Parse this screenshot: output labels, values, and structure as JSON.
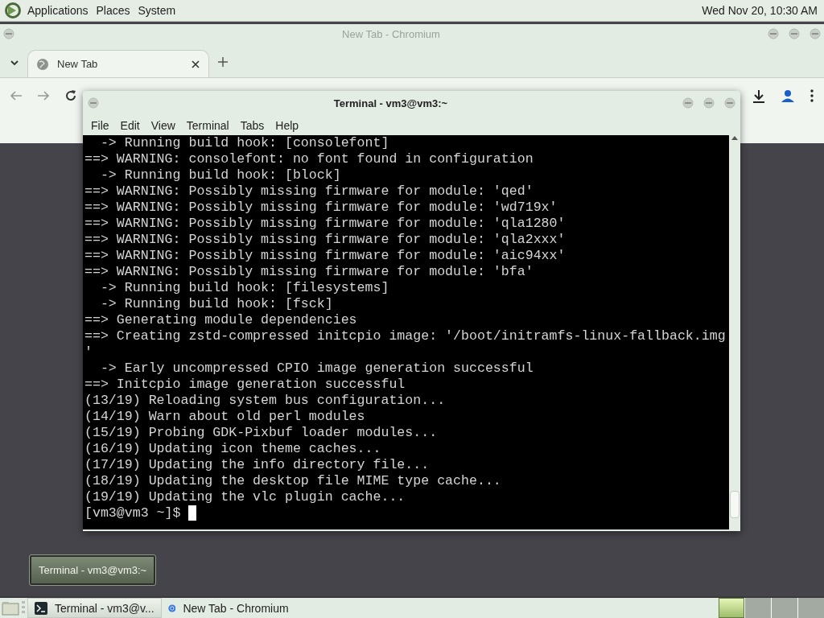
{
  "top_panel": {
    "menus": [
      "Applications",
      "Places",
      "System"
    ],
    "clock": "Wed Nov 20, 10:30 AM"
  },
  "browser_window": {
    "title": "New Tab - Chromium",
    "active": false,
    "tabs": [
      {
        "label": "New Tab",
        "selected": true
      }
    ]
  },
  "terminal_window": {
    "title": "Terminal - vm3@vm3:~",
    "active": true,
    "menus": [
      "File",
      "Edit",
      "View",
      "Terminal",
      "Tabs",
      "Help"
    ],
    "lines": [
      "  -> Running build hook: [consolefont]",
      "==> WARNING: consolefont: no font found in configuration",
      "  -> Running build hook: [block]",
      "==> WARNING: Possibly missing firmware for module: 'qed'",
      "==> WARNING: Possibly missing firmware for module: 'wd719x'",
      "==> WARNING: Possibly missing firmware for module: 'qla1280'",
      "==> WARNING: Possibly missing firmware for module: 'qla2xxx'",
      "==> WARNING: Possibly missing firmware for module: 'aic94xx'",
      "==> WARNING: Possibly missing firmware for module: 'bfa'",
      "  -> Running build hook: [filesystems]",
      "  -> Running build hook: [fsck]",
      "==> Generating module dependencies",
      "==> Creating zstd-compressed initcpio image: '/boot/initramfs-linux-fallback.img",
      "'",
      "  -> Early uncompressed CPIO image generation successful",
      "==> Initcpio image generation successful",
      "(13/19) Reloading system bus configuration...",
      "(14/19) Warn about old perl modules",
      "(15/19) Probing GDK-Pixbuf loader modules...",
      "(16/19) Updating icon theme caches...",
      "(17/19) Updating the info directory file...",
      "(18/19) Updating the desktop file MIME type cache...",
      "(19/19) Updating the vlc plugin cache..."
    ],
    "prompt": "[vm3@vm3 ~]$ "
  },
  "tooltip": "Terminal - vm3@vm3:~",
  "taskbar": {
    "tasks": [
      {
        "kind": "terminal",
        "label": "Terminal - vm3@v...",
        "selected": true
      },
      {
        "kind": "browser",
        "label": "New Tab - Chromium",
        "selected": false
      }
    ],
    "workspaces": [
      {
        "selected": true
      },
      {
        "selected": false
      },
      {
        "selected": false
      },
      {
        "selected": false
      }
    ]
  }
}
